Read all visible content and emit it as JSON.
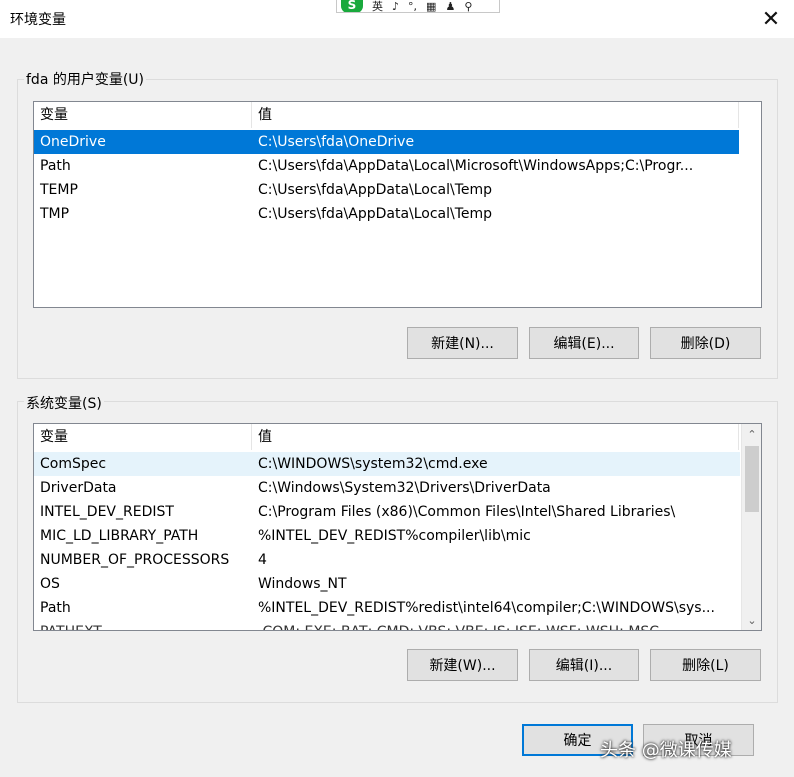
{
  "window": {
    "title": "环境变量",
    "close_glyph": "✕"
  },
  "ime_toolbar": {
    "logo": "S",
    "items": [
      "英",
      "♪",
      "°,",
      "▦",
      "♟",
      "⚲"
    ]
  },
  "user_vars": {
    "group_label": "fda 的用户变量(U)",
    "columns": [
      "变量",
      "值"
    ],
    "rows": [
      {
        "name": "OneDrive",
        "value": "C:\\Users\\fda\\OneDrive"
      },
      {
        "name": "Path",
        "value": "C:\\Users\\fda\\AppData\\Local\\Microsoft\\WindowsApps;C:\\Progr..."
      },
      {
        "name": "TEMP",
        "value": "C:\\Users\\fda\\AppData\\Local\\Temp"
      },
      {
        "name": "TMP",
        "value": "C:\\Users\\fda\\AppData\\Local\\Temp"
      }
    ],
    "buttons": {
      "new": "新建(N)...",
      "edit": "编辑(E)...",
      "delete": "删除(D)"
    }
  },
  "system_vars": {
    "group_label": "系统变量(S)",
    "columns": [
      "变量",
      "值"
    ],
    "rows": [
      {
        "name": "ComSpec",
        "value": "C:\\WINDOWS\\system32\\cmd.exe"
      },
      {
        "name": "DriverData",
        "value": "C:\\Windows\\System32\\Drivers\\DriverData"
      },
      {
        "name": "INTEL_DEV_REDIST",
        "value": "C:\\Program Files (x86)\\Common Files\\Intel\\Shared Libraries\\"
      },
      {
        "name": "MIC_LD_LIBRARY_PATH",
        "value": "%INTEL_DEV_REDIST%compiler\\lib\\mic"
      },
      {
        "name": "NUMBER_OF_PROCESSORS",
        "value": "4"
      },
      {
        "name": "OS",
        "value": "Windows_NT"
      },
      {
        "name": "Path",
        "value": "%INTEL_DEV_REDIST%redist\\intel64\\compiler;C:\\WINDOWS\\sys..."
      },
      {
        "name": "PATHEXT",
        "value": ".COM;.EXE;.BAT;.CMD;.VBS;.VBE;.JS;.JSE;.WSF;.WSH;.MSC"
      }
    ],
    "scroll_up": "⌃",
    "scroll_down": "⌄",
    "buttons": {
      "new": "新建(W)...",
      "edit": "编辑(I)...",
      "delete": "删除(L)"
    }
  },
  "dialog_buttons": {
    "ok": "确定",
    "cancel": "取消"
  },
  "watermark": "头条 @微课传媒",
  "colors": {
    "selection": "#0078d7",
    "row_hover": "#e5f3fb",
    "ime_brand": "#19a93c"
  }
}
